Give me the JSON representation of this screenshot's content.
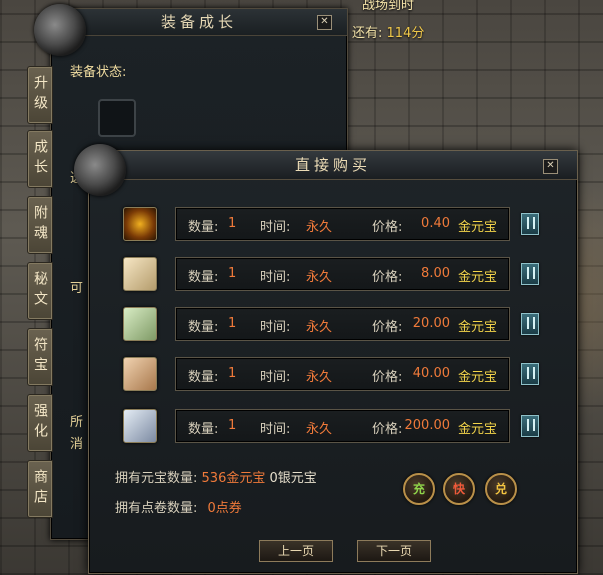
{
  "hud": {
    "line1_label": "战场到时",
    "line2_label": "还有:",
    "line2_value": "114分"
  },
  "bg_panel": {
    "title": "装备成长",
    "equip_status_label": "装备状态:",
    "trunc_1": "可",
    "trunc_2": "所",
    "trunc_3": "消",
    "trunc_4": "选"
  },
  "side_tabs": [
    "升级",
    "成长",
    "附魂",
    "秘文",
    "符宝",
    "强化",
    "商店"
  ],
  "dialog": {
    "title": "直接购买",
    "labels": {
      "qty": "数量:",
      "time": "时间:",
      "price": "价格:"
    },
    "items": [
      {
        "qty": "1",
        "time": "永久",
        "price": "0.40",
        "currency": "金元宝",
        "icon": "golden-dragon-gem-icon"
      },
      {
        "qty": "1",
        "time": "永久",
        "price": "8.00",
        "currency": "金元宝",
        "icon": "red-rune-tile-icon"
      },
      {
        "qty": "1",
        "time": "永久",
        "price": "20.00",
        "currency": "金元宝",
        "icon": "green-rune-tile-icon"
      },
      {
        "qty": "1",
        "time": "永久",
        "price": "40.00",
        "currency": "金元宝",
        "icon": "orange-rune-tile-icon"
      },
      {
        "qty": "1",
        "time": "永久",
        "price": "200.00",
        "currency": "金元宝",
        "icon": "purple-rune-tile-icon"
      }
    ],
    "owned_yuanbao_label": "拥有元宝数量:",
    "owned_gold_value": "536金元宝",
    "owned_silver_value": "0银元宝",
    "owned_points_label": "拥有点卷数量:",
    "owned_points_value": "0点券",
    "action_buttons": [
      "充",
      "快",
      "兑"
    ],
    "prev_page": "上一页",
    "next_page": "下一页"
  },
  "colors": {
    "accent_orange": "#f07a3a",
    "gold": "#f3d44a",
    "frame": "#6a604d"
  }
}
